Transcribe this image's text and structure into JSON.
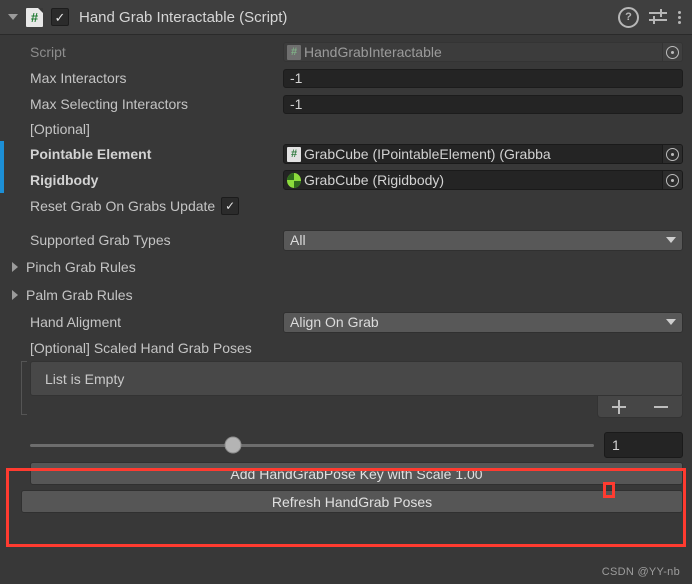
{
  "header": {
    "title": "Hand Grab Interactable (Script)",
    "enabled_checkmark": "✓",
    "help_glyph": "?",
    "icons": [
      "help-icon",
      "preset-icon",
      "context-menu-icon"
    ]
  },
  "fields": {
    "script": {
      "label": "Script",
      "value": "HandGrabInteractable",
      "hash": "#"
    },
    "max_interactors": {
      "label": "Max Interactors",
      "value": "-1"
    },
    "max_selecting_interactors": {
      "label": "Max Selecting Interactors",
      "value": "-1"
    },
    "optional_header": "[Optional]",
    "pointable_element": {
      "label": "Pointable Element",
      "value": "GrabCube (IPointableElement) (Grabba",
      "hash": "#"
    },
    "rigidbody": {
      "label": "Rigidbody",
      "value": "GrabCube (Rigidbody)"
    },
    "reset_grab": {
      "label": "Reset Grab On Grabs Update",
      "checked": "✓"
    },
    "supported_grab_types": {
      "label": "Supported Grab Types",
      "value": "All"
    },
    "pinch_grab_rules": {
      "label": "Pinch Grab Rules"
    },
    "palm_grab_rules": {
      "label": "Palm Grab Rules"
    },
    "hand_aligment": {
      "label": "Hand Aligment",
      "value": "Align On Grab"
    }
  },
  "list_section": {
    "title": "[Optional] Scaled Hand Grab Poses",
    "empty_text": "List is Empty",
    "add_button": "+",
    "remove_button": "−"
  },
  "scale_controls": {
    "slider_value": "1",
    "slider_percent": 36,
    "add_pose_button": "Add HandGrabPose Key with Scale 1.00",
    "refresh_button": "Refresh HandGrab Poses"
  },
  "watermark": "CSDN @YY-nb",
  "colors": {
    "background": "#383838",
    "header_bg": "#3f3f3f",
    "override_bar": "#1c8fd6",
    "accent_red": "#ff3b30",
    "input_bg": "#242424",
    "dropdown_bg": "#585858"
  }
}
